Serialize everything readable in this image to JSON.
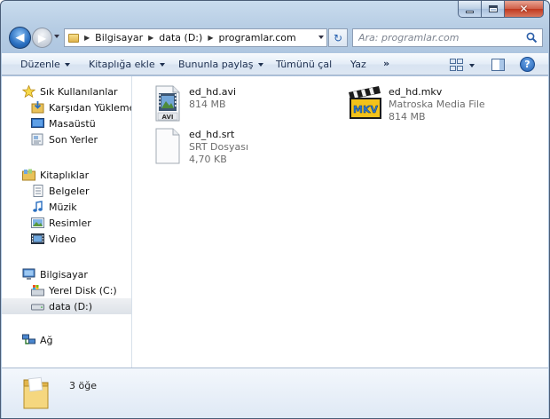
{
  "window": {
    "caption_buttons": [
      "minimize",
      "maximize",
      "close"
    ],
    "close_glyph": "✕"
  },
  "nav": {
    "back_glyph": "◀",
    "forward_glyph": "▶",
    "breadcrumb": [
      "Bilgisayar",
      "data (D:)",
      "programlar.com"
    ],
    "refresh_glyph": "↻",
    "search_placeholder": "Ara: programlar.com"
  },
  "toolbar": {
    "items": [
      "Düzenle",
      "Kitaplığa ekle",
      "Bununla paylaş",
      "Tümünü çal",
      "Yaz"
    ],
    "more": "»",
    "help_glyph": "?"
  },
  "nav_pane": {
    "favorites": {
      "label": "Sık Kullanılanlar",
      "icon": "star-icon",
      "items": [
        {
          "label": "Karşıdan Yüklemeler",
          "icon": "downloads-icon"
        },
        {
          "label": "Masaüstü",
          "icon": "desktop-icon"
        },
        {
          "label": "Son Yerler",
          "icon": "recent-places-icon"
        }
      ]
    },
    "libraries": {
      "label": "Kitaplıklar",
      "icon": "libraries-icon",
      "items": [
        {
          "label": "Belgeler",
          "icon": "documents-icon"
        },
        {
          "label": "Müzik",
          "icon": "music-icon"
        },
        {
          "label": "Resimler",
          "icon": "pictures-icon"
        },
        {
          "label": "Video",
          "icon": "video-icon"
        }
      ]
    },
    "computer": {
      "label": "Bilgisayar",
      "icon": "computer-icon",
      "items": [
        {
          "label": "Yerel Disk (C:)",
          "icon": "local-disk-icon"
        },
        {
          "label": "data (D:)",
          "icon": "drive-icon",
          "selected": true
        }
      ]
    },
    "network": {
      "label": "Ağ",
      "icon": "network-icon"
    }
  },
  "files": [
    {
      "name": "ed_hd.avi",
      "type": "",
      "size": "814 MB",
      "icon": "avi-file-icon"
    },
    {
      "name": "ed_hd.srt",
      "type": "SRT Dosyası",
      "size": "4,70 KB",
      "icon": "blank-file-icon"
    },
    {
      "name": "ed_hd.mkv",
      "type": "Matroska Media File",
      "size": "814 MB",
      "icon": "mkv-file-icon",
      "badge": "MKV"
    }
  ],
  "details": {
    "count": "3 öğe",
    "icon": "folder-icon"
  },
  "colors": {
    "accent": "#2a6fc0",
    "selection": "#dde2e8",
    "meta_text": "#6d6d6d"
  }
}
